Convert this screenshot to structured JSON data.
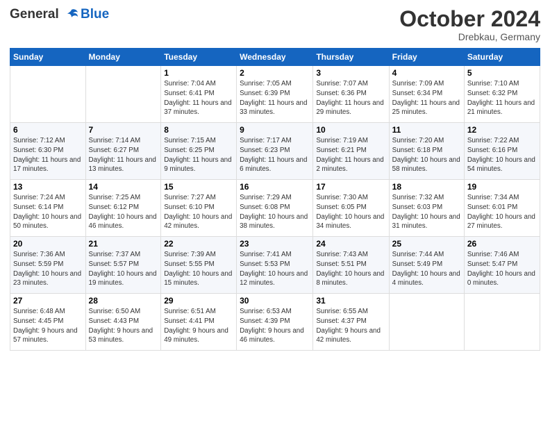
{
  "header": {
    "logo_line1": "General",
    "logo_line2": "Blue",
    "month_title": "October 2024",
    "location": "Drebkau, Germany"
  },
  "weekdays": [
    "Sunday",
    "Monday",
    "Tuesday",
    "Wednesday",
    "Thursday",
    "Friday",
    "Saturday"
  ],
  "weeks": [
    [
      {
        "day": "",
        "sunrise": "",
        "sunset": "",
        "daylight": ""
      },
      {
        "day": "",
        "sunrise": "",
        "sunset": "",
        "daylight": ""
      },
      {
        "day": "1",
        "sunrise": "Sunrise: 7:04 AM",
        "sunset": "Sunset: 6:41 PM",
        "daylight": "Daylight: 11 hours and 37 minutes."
      },
      {
        "day": "2",
        "sunrise": "Sunrise: 7:05 AM",
        "sunset": "Sunset: 6:39 PM",
        "daylight": "Daylight: 11 hours and 33 minutes."
      },
      {
        "day": "3",
        "sunrise": "Sunrise: 7:07 AM",
        "sunset": "Sunset: 6:36 PM",
        "daylight": "Daylight: 11 hours and 29 minutes."
      },
      {
        "day": "4",
        "sunrise": "Sunrise: 7:09 AM",
        "sunset": "Sunset: 6:34 PM",
        "daylight": "Daylight: 11 hours and 25 minutes."
      },
      {
        "day": "5",
        "sunrise": "Sunrise: 7:10 AM",
        "sunset": "Sunset: 6:32 PM",
        "daylight": "Daylight: 11 hours and 21 minutes."
      }
    ],
    [
      {
        "day": "6",
        "sunrise": "Sunrise: 7:12 AM",
        "sunset": "Sunset: 6:30 PM",
        "daylight": "Daylight: 11 hours and 17 minutes."
      },
      {
        "day": "7",
        "sunrise": "Sunrise: 7:14 AM",
        "sunset": "Sunset: 6:27 PM",
        "daylight": "Daylight: 11 hours and 13 minutes."
      },
      {
        "day": "8",
        "sunrise": "Sunrise: 7:15 AM",
        "sunset": "Sunset: 6:25 PM",
        "daylight": "Daylight: 11 hours and 9 minutes."
      },
      {
        "day": "9",
        "sunrise": "Sunrise: 7:17 AM",
        "sunset": "Sunset: 6:23 PM",
        "daylight": "Daylight: 11 hours and 6 minutes."
      },
      {
        "day": "10",
        "sunrise": "Sunrise: 7:19 AM",
        "sunset": "Sunset: 6:21 PM",
        "daylight": "Daylight: 11 hours and 2 minutes."
      },
      {
        "day": "11",
        "sunrise": "Sunrise: 7:20 AM",
        "sunset": "Sunset: 6:18 PM",
        "daylight": "Daylight: 10 hours and 58 minutes."
      },
      {
        "day": "12",
        "sunrise": "Sunrise: 7:22 AM",
        "sunset": "Sunset: 6:16 PM",
        "daylight": "Daylight: 10 hours and 54 minutes."
      }
    ],
    [
      {
        "day": "13",
        "sunrise": "Sunrise: 7:24 AM",
        "sunset": "Sunset: 6:14 PM",
        "daylight": "Daylight: 10 hours and 50 minutes."
      },
      {
        "day": "14",
        "sunrise": "Sunrise: 7:25 AM",
        "sunset": "Sunset: 6:12 PM",
        "daylight": "Daylight: 10 hours and 46 minutes."
      },
      {
        "day": "15",
        "sunrise": "Sunrise: 7:27 AM",
        "sunset": "Sunset: 6:10 PM",
        "daylight": "Daylight: 10 hours and 42 minutes."
      },
      {
        "day": "16",
        "sunrise": "Sunrise: 7:29 AM",
        "sunset": "Sunset: 6:08 PM",
        "daylight": "Daylight: 10 hours and 38 minutes."
      },
      {
        "day": "17",
        "sunrise": "Sunrise: 7:30 AM",
        "sunset": "Sunset: 6:05 PM",
        "daylight": "Daylight: 10 hours and 34 minutes."
      },
      {
        "day": "18",
        "sunrise": "Sunrise: 7:32 AM",
        "sunset": "Sunset: 6:03 PM",
        "daylight": "Daylight: 10 hours and 31 minutes."
      },
      {
        "day": "19",
        "sunrise": "Sunrise: 7:34 AM",
        "sunset": "Sunset: 6:01 PM",
        "daylight": "Daylight: 10 hours and 27 minutes."
      }
    ],
    [
      {
        "day": "20",
        "sunrise": "Sunrise: 7:36 AM",
        "sunset": "Sunset: 5:59 PM",
        "daylight": "Daylight: 10 hours and 23 minutes."
      },
      {
        "day": "21",
        "sunrise": "Sunrise: 7:37 AM",
        "sunset": "Sunset: 5:57 PM",
        "daylight": "Daylight: 10 hours and 19 minutes."
      },
      {
        "day": "22",
        "sunrise": "Sunrise: 7:39 AM",
        "sunset": "Sunset: 5:55 PM",
        "daylight": "Daylight: 10 hours and 15 minutes."
      },
      {
        "day": "23",
        "sunrise": "Sunrise: 7:41 AM",
        "sunset": "Sunset: 5:53 PM",
        "daylight": "Daylight: 10 hours and 12 minutes."
      },
      {
        "day": "24",
        "sunrise": "Sunrise: 7:43 AM",
        "sunset": "Sunset: 5:51 PM",
        "daylight": "Daylight: 10 hours and 8 minutes."
      },
      {
        "day": "25",
        "sunrise": "Sunrise: 7:44 AM",
        "sunset": "Sunset: 5:49 PM",
        "daylight": "Daylight: 10 hours and 4 minutes."
      },
      {
        "day": "26",
        "sunrise": "Sunrise: 7:46 AM",
        "sunset": "Sunset: 5:47 PM",
        "daylight": "Daylight: 10 hours and 0 minutes."
      }
    ],
    [
      {
        "day": "27",
        "sunrise": "Sunrise: 6:48 AM",
        "sunset": "Sunset: 4:45 PM",
        "daylight": "Daylight: 9 hours and 57 minutes."
      },
      {
        "day": "28",
        "sunrise": "Sunrise: 6:50 AM",
        "sunset": "Sunset: 4:43 PM",
        "daylight": "Daylight: 9 hours and 53 minutes."
      },
      {
        "day": "29",
        "sunrise": "Sunrise: 6:51 AM",
        "sunset": "Sunset: 4:41 PM",
        "daylight": "Daylight: 9 hours and 49 minutes."
      },
      {
        "day": "30",
        "sunrise": "Sunrise: 6:53 AM",
        "sunset": "Sunset: 4:39 PM",
        "daylight": "Daylight: 9 hours and 46 minutes."
      },
      {
        "day": "31",
        "sunrise": "Sunrise: 6:55 AM",
        "sunset": "Sunset: 4:37 PM",
        "daylight": "Daylight: 9 hours and 42 minutes."
      },
      {
        "day": "",
        "sunrise": "",
        "sunset": "",
        "daylight": ""
      },
      {
        "day": "",
        "sunrise": "",
        "sunset": "",
        "daylight": ""
      }
    ]
  ]
}
